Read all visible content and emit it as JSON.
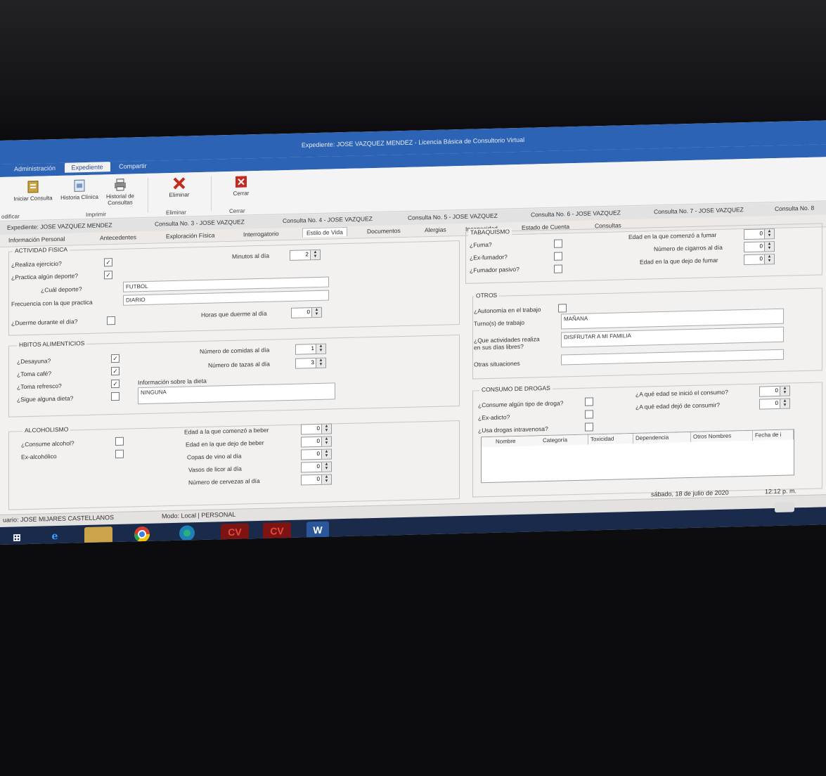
{
  "window": {
    "title": "Expediente: JOSE VAZQUEZ MENDEZ - Licencia Básica de Consultorio Virtual"
  },
  "ribbon_tabs": [
    "Administración",
    "Expediente",
    "Compartir"
  ],
  "ribbon": {
    "iniciar": "Iniciar Consulta",
    "historia": "Historia Clínica",
    "historial": "Historial de Consultas",
    "eliminar": "Eliminar",
    "cerrar": "Cerrar",
    "groups": [
      "odificar",
      "Imprimir",
      "Eliminar",
      "Cerrar"
    ]
  },
  "consult_tabs": [
    "Expediente: JOSE VAZQUEZ MENDEZ",
    "Consulta No. 3 - JOSE VAZQUEZ",
    "Consulta No. 4 - JOSE VAZQUEZ",
    "Consulta No. 5 - JOSE VAZQUEZ",
    "Consulta No. 6 - JOSE VAZQUEZ",
    "Consulta No. 7 - JOSE VAZQUEZ",
    "Consulta No. 8"
  ],
  "section_tabs": [
    "Información Personal",
    "Antecedentes",
    "Exploración Física",
    "Interrogatorio",
    "Estilo de Vida",
    "Documentos",
    "Alergias",
    "Incapacidad",
    "Estado de Cuenta",
    "Consultas"
  ],
  "actividad": {
    "legend": "ACTIVIDAD FISICA",
    "ejercicio": "¿Realiza ejercicio?",
    "minutos_label": "Minutos al día",
    "minutos": "2",
    "deporte": "¿Practica algún deporte?",
    "cual_label": "¿Cuál deporte?",
    "cual": "FUTBOL",
    "frecuencia_label": "Frecuencia con la que practica",
    "frecuencia": "DIARIO",
    "duerme": "¿Duerme durante el día?",
    "horas_label": "Horas que duerme al día",
    "horas": "0"
  },
  "habitos": {
    "legend": "HBITOS ALIMENTICIOS",
    "desayuna": "¿Desayuna?",
    "cafe": "¿Toma café?",
    "refresco": "¿Toma refresco?",
    "dieta": "¿Sigue alguna dieta?",
    "comidas_label": "Número de comidas al día",
    "comidas": "1",
    "tazas_label": "Número de tazas al día",
    "tazas": "3",
    "info_label": "Información sobre la dieta",
    "info": "NINGUNA"
  },
  "alcohol": {
    "legend": "ALCOHOLISMO",
    "consume": "¿Consume alcohol?",
    "ex": "Ex-alcohólico",
    "fields": [
      {
        "label": "Edad a la que comenzó a beber",
        "value": "0"
      },
      {
        "label": "Edad en la que dejo de beber",
        "value": "0"
      },
      {
        "label": "Copas de vino al día",
        "value": "0"
      },
      {
        "label": "Vasos de licor al día",
        "value": "0"
      },
      {
        "label": "Número de cervezas al día",
        "value": "0"
      }
    ]
  },
  "tabaquismo": {
    "legend": "TABAQUISMO",
    "fuma": "¿Fuma?",
    "exfumador": "¿Ex-fumador?",
    "pasivo": "¿Fumador pasivo?",
    "fields": [
      {
        "label": "Edad en la que comenzó a fumar",
        "value": "0"
      },
      {
        "label": "Número de cigarros al día",
        "value": "0"
      },
      {
        "label": "Edad en la que dejo de fumar",
        "value": "0"
      }
    ]
  },
  "otros": {
    "legend": "OTROS",
    "autonomia": "¿Autonomía en el trabajo",
    "turno_label": "Turno(s) de trabajo",
    "turno": "MAÑANA",
    "actividades_label1": "¿Que actividades realiza",
    "actividades_label2": "en sus días libres?",
    "actividades": "DISFRUTAR A MI FAMILIA",
    "situaciones_label": "Otras situaciones",
    "situaciones": ""
  },
  "drogas": {
    "legend": "CONSUMO DE DROGAS",
    "consume": "¿Consume algún tipo de droga?",
    "exadicto": "¿Ex-adicto?",
    "intravenosa": "¿Usa drogas intravenosa?",
    "inicio_label": "¿A qué edad se inició el consumo?",
    "inicio": "0",
    "dejo_label": "¿A qué edad dejó de consumir?",
    "dejo": "0",
    "columns": [
      "Nombre",
      "Categoría",
      "Toxicidad",
      "Dependencia",
      "Otros Nombres",
      "Fecha de i"
    ]
  },
  "status": {
    "date": "sábado, 18 de julio de 2020",
    "time": "12:12 p. m.",
    "user": "uario: JOSE MIJARES CASTELLANOS",
    "mode": "Modo: Local | PERSONAL"
  },
  "taskbar": {
    "cv1": "CV",
    "cv2": "CV",
    "word": "W"
  }
}
